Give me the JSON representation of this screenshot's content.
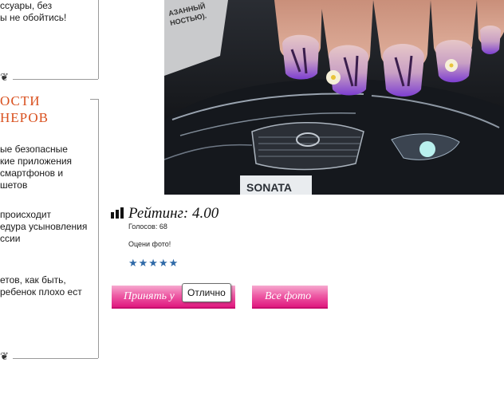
{
  "sidebar": {
    "snippet_top": [
      "ссуары, без",
      "ы не обойтись!"
    ],
    "section_title": [
      "ОСТИ",
      "НЕРОВ"
    ],
    "news": [
      [
        "ые безопасные",
        "кие приложения",
        "смартфонов и",
        "шетов"
      ],
      [
        "происходит",
        "едура усыновления",
        "ссии"
      ],
      [
        "етов, как быть,",
        "ребенок плохо ест"
      ]
    ]
  },
  "photo": {
    "car_text": "SONATA",
    "magazine_text_1": "АЗАННЫЙ",
    "magazine_text_2": "НОСТЬЮ)."
  },
  "rating": {
    "title": "Рейтинг: 4.00",
    "votes": "Голосов: 68",
    "prompt": "Оцени фото!",
    "stars": "★★★★★"
  },
  "buttons": {
    "accept_label": "Принять у",
    "all_photos_label": "Все фото"
  },
  "tooltip": "Отлично",
  "colors": {
    "accent": "#d9501e",
    "button_pink": "#e0197f",
    "star_blue": "#2f6aa8"
  }
}
